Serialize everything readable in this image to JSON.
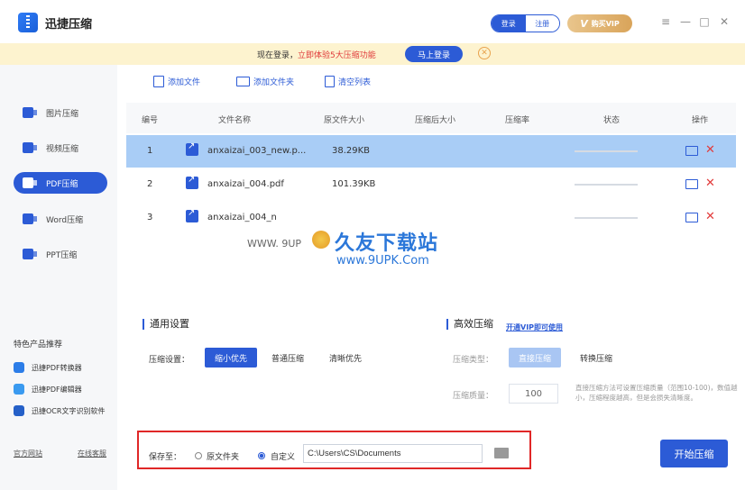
{
  "app": {
    "title": "迅捷压缩"
  },
  "header": {
    "login_label": "登录",
    "register_label": "注册",
    "vip_label": "购买VIP",
    "vip_badge": "V"
  },
  "notice": {
    "text_prefix": "现在登录，",
    "text_highlight": "立即体验5大压缩功能",
    "login_button": "马上登录"
  },
  "sidebar": {
    "items": [
      {
        "label": "图片压缩"
      },
      {
        "label": "视频压缩"
      },
      {
        "label": "PDF压缩"
      },
      {
        "label": "Word压缩"
      },
      {
        "label": "PPT压缩"
      }
    ],
    "featured_title": "特色产品推荐",
    "featured": [
      {
        "label": "迅捷PDF转换器"
      },
      {
        "label": "迅捷PDF编辑器"
      },
      {
        "label": "迅捷OCR文字识别软件"
      }
    ],
    "footer_left": "官方网站",
    "footer_right": "在线客服"
  },
  "toolbar": {
    "add_file": "添加文件",
    "add_folder": "添加文件夹",
    "clear_list": "清空列表"
  },
  "table": {
    "headers": [
      "编号",
      "文件名称",
      "原文件大小",
      "压缩后大小",
      "压缩率",
      "状态",
      "操作"
    ],
    "rows": [
      {
        "index": "1",
        "name": "anxaizai_003_new.p...",
        "size": "38.29KB"
      },
      {
        "index": "2",
        "name": "anxaizai_004.pdf",
        "size": "101.39KB"
      },
      {
        "index": "3",
        "name": "anxaizai_004_n",
        "size": ""
      }
    ]
  },
  "watermark": {
    "sub": "WWW. 9UP",
    "big": "久友下载站",
    "url": "www.9UPK.Com"
  },
  "settings": {
    "general_title": "通用设置",
    "compress_label": "压缩设置：",
    "options": [
      "缩小优先",
      "普通压缩",
      "清晰优先"
    ],
    "advanced_title": "高效压缩",
    "vip_link": "开通VIP即可使用",
    "type_label": "压缩类型：",
    "type_options": [
      "直接压缩",
      "转换压缩"
    ],
    "quality_label": "压缩质量：",
    "quality_value": "100",
    "hint": "直接压缩方法可设置压缩质量（范围10-100)，数值越小，压缩程度越高，但是会损失清晰度。"
  },
  "save": {
    "label": "保存至：",
    "option_original": "原文件夹",
    "option_custom": "自定义",
    "path": "C:\\Users\\CS\\Documents"
  },
  "start_button": "开始压缩"
}
